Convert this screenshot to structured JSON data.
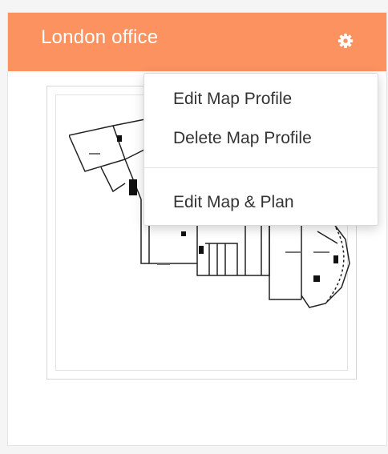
{
  "card": {
    "title": "London office",
    "header_color": "#fb9260",
    "settings_icon": "gear-icon"
  },
  "menu": {
    "items": [
      {
        "label": "Edit Map Profile"
      },
      {
        "label": "Delete Map Profile"
      },
      {
        "label": "Edit Map & Plan"
      }
    ]
  }
}
